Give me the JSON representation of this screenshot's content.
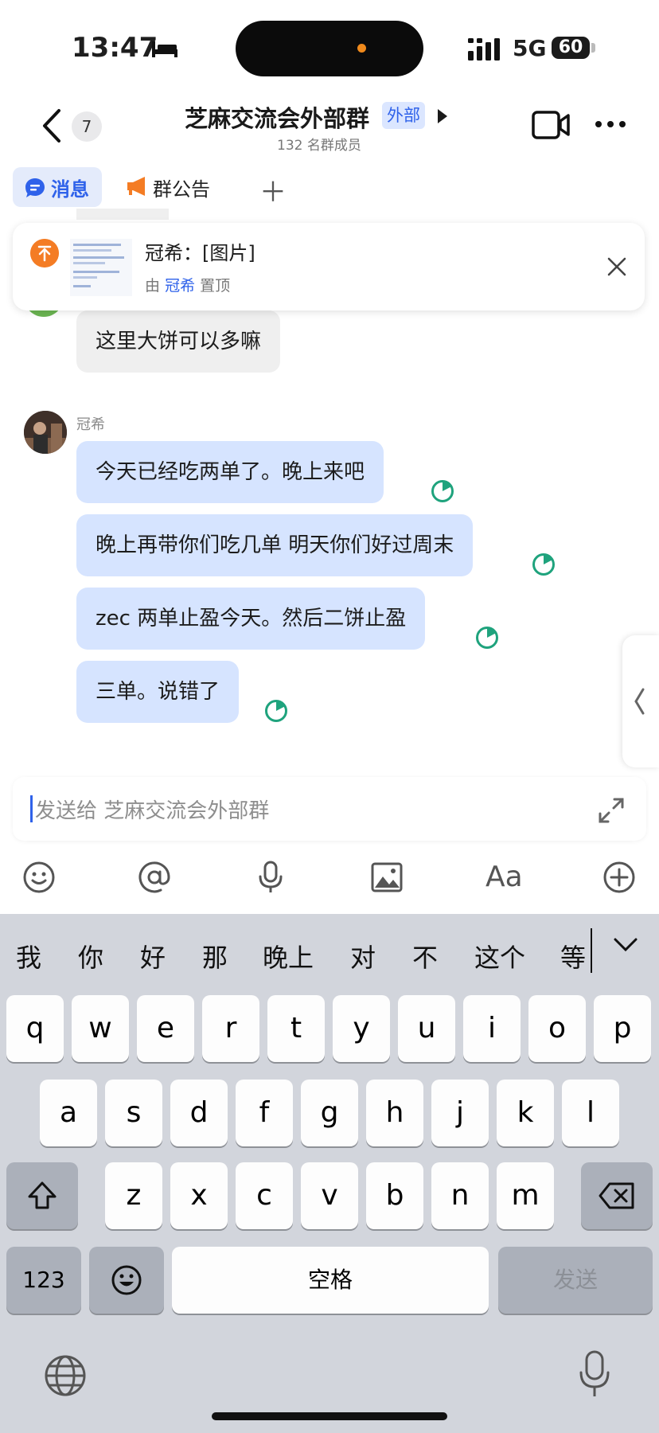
{
  "status": {
    "time": "13:47",
    "network": "5G",
    "battery": "60"
  },
  "header": {
    "back_badge": "7",
    "title": "芝麻交流会外部群",
    "external_badge": "外部",
    "subtitle": "132 名群成员"
  },
  "tabs": [
    {
      "label": "消息",
      "active": true
    },
    {
      "label": "群公告",
      "active": false
    }
  ],
  "pinned": {
    "sender": "冠希",
    "content": "冠希：[图片]",
    "by_prefix": "由",
    "by_name": "冠希",
    "by_suffix": "置顶"
  },
  "messages": {
    "prev_gray": "这里大饼可以多嘛",
    "sender": "冠希",
    "items": [
      "今天已经吃两单了。晚上来吧",
      "晚上再带你们吃几单 明天你们好过周末",
      "zec 两单止盈今天。然后二饼止盈",
      "三单。说错了"
    ]
  },
  "composer": {
    "placeholder": "发送给 芝麻交流会外部群"
  },
  "toolbar_icons": [
    "emoji-icon",
    "mention-icon",
    "voice-icon",
    "image-icon",
    "text-format-icon",
    "add-circle-icon"
  ],
  "toolbar_text_format": "Aa",
  "keyboard": {
    "candidates": [
      "我",
      "你",
      "好",
      "那",
      "晚上",
      "对",
      "不",
      "这个",
      "等"
    ],
    "row1": [
      "q",
      "w",
      "e",
      "r",
      "t",
      "y",
      "u",
      "i",
      "o",
      "p"
    ],
    "row2": [
      "a",
      "s",
      "d",
      "f",
      "g",
      "h",
      "j",
      "k",
      "l"
    ],
    "row3": [
      "z",
      "x",
      "c",
      "v",
      "b",
      "n",
      "m"
    ],
    "numbers_key": "123",
    "space_key": "空格",
    "send_key": "发送"
  },
  "colors": {
    "accent": "#2f62ea",
    "bubble_blue": "#d6e4ff",
    "bubble_gray": "#efefef",
    "read_green": "#1fa37d"
  }
}
